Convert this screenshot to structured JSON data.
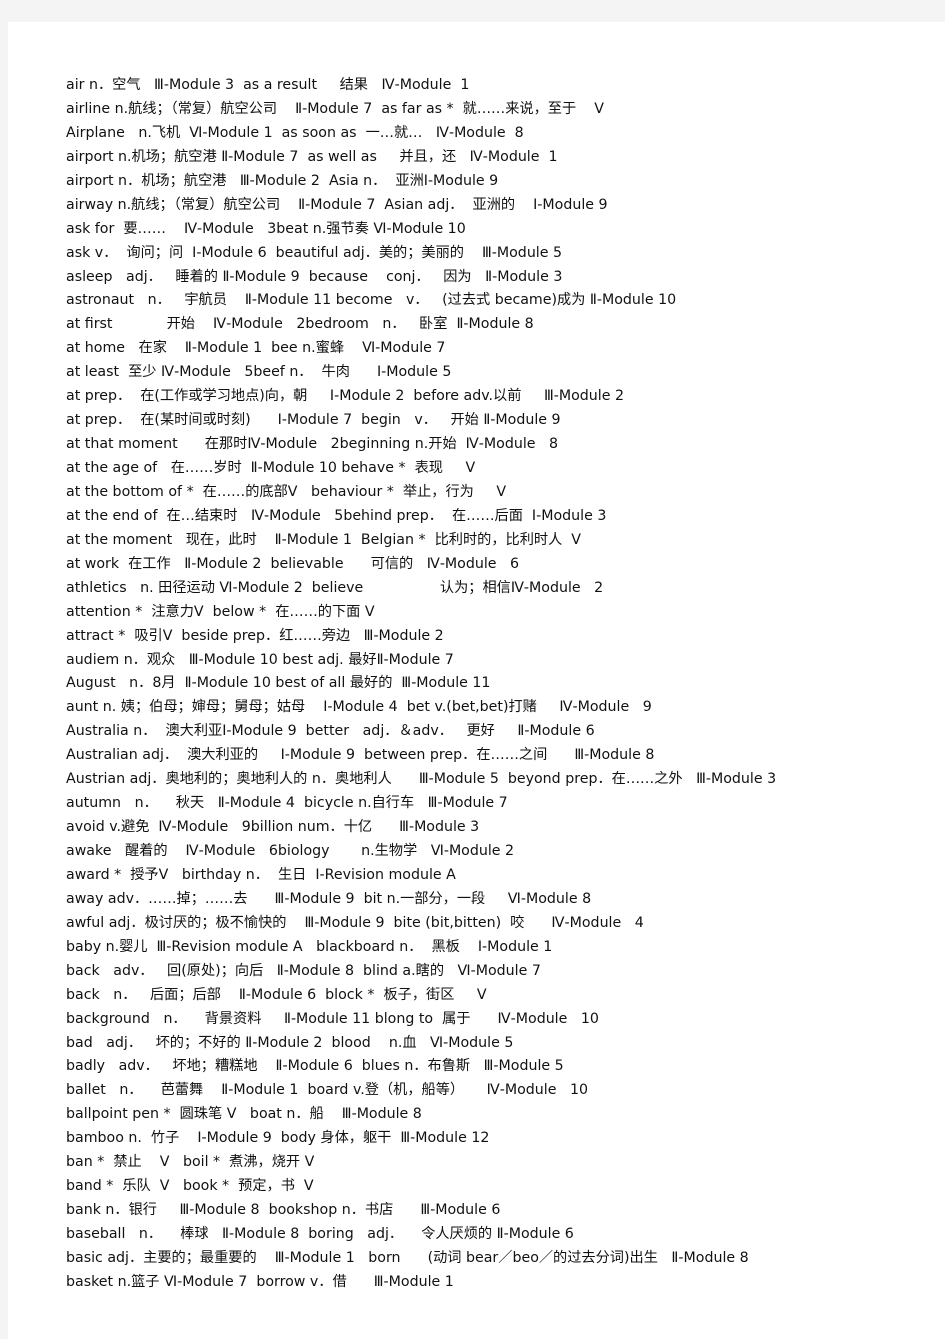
{
  "document": {
    "lines": [
      "air n．空气   Ⅲ-Module 3  as a result     结果   Ⅳ-Module  1",
      "airline n.航线；（常复）航空公司    Ⅱ-Module 7  as far as *  就……来说，至于    Ⅴ",
      "Airplane   n.飞机  Ⅵ-Module 1  as soon as  一…就…   Ⅳ-Module  8",
      "airport n.机场；航空港 Ⅱ-Module 7  as well as     并且，还   Ⅳ-Module  1",
      "airport n．机场；航空港   Ⅲ-Module 2  Asia n．  亚洲Ⅰ-Module 9",
      "airway n.航线；（常复）航空公司    Ⅱ-Module 7  Asian adj．  亚洲的    Ⅰ-Module 9",
      "ask for  要……    Ⅳ-Module   3beat n.强节奏 Ⅵ-Module 10",
      "ask v．  询问；问  Ⅰ-Module 6  beautiful adj．美的；美丽的    Ⅲ-Module 5",
      "asleep   adj．   睡着的 Ⅱ-Module 9  because    conj．   因为   Ⅱ-Module 3",
      "astronaut   n．   宇航员    Ⅱ-Module 11 become   v．   (过去式 became)成为 Ⅱ-Module 10",
      "at first            开始    Ⅳ-Module   2bedroom   n．   卧室  Ⅱ-Module 8",
      "at home   在家    Ⅱ-Module 1  bee n.蜜蜂    Ⅵ-Module 7",
      "at least  至少 Ⅳ-Module   5beef n．  牛肉      Ⅰ-Module 5",
      "at prep．  在(工作或学习地点)向，朝     Ⅰ-Module 2  before adv.以前     Ⅲ-Module 2",
      "at prep．  在(某时间或时刻)      Ⅰ-Module 7  begin   v．   开始 Ⅱ-Module 9",
      "at that moment      在那时Ⅳ-Module   2beginning n.开始  Ⅳ-Module   8",
      "at the age of   在……岁时  Ⅱ-Module 10 behave *  表现     Ⅴ",
      "at the bottom of *  在……的底部Ⅴ   behaviour *  举止，行为     Ⅴ",
      "at the end of  在…结束时   Ⅳ-Module   5behind prep．  在……后面  Ⅰ-Module 3",
      "at the moment   现在，此时    Ⅱ-Module 1  Belgian *  比利时的，比利时人  Ⅴ",
      "at work  在工作   Ⅱ-Module 2  believable      可信的   Ⅳ-Module   6",
      "athletics   n. 田径运动 Ⅵ-Module 2  believe                 认为；相信Ⅳ-Module   2",
      "attention *  注意力Ⅴ  below *  在……的下面 Ⅴ",
      "attract *  吸引Ⅴ  beside prep．红……旁边   Ⅲ-Module 2",
      "audiem n．观众   Ⅲ-Module 10 best adj. 最好Ⅱ-Module 7",
      "August   n．8月  Ⅱ-Module 10 best of all 最好的  Ⅲ-Module 11",
      "aunt n. 姨；伯母；婶母；舅母；姑母    Ⅰ-Module 4  bet v.(bet,bet)打赌     Ⅳ-Module   9",
      "Australia n．  澳大利亚Ⅰ-Module 9  better   adj．＆adv．   更好     Ⅱ-Module 6",
      "Australian adj．  澳大利亚的     Ⅰ-Module 9  between prep．在……之间      Ⅲ-Module 8",
      "Austrian adj．奥地利的；奥地利人的 n．奥地利人      Ⅲ-Module 5  beyond prep．在……之外   Ⅲ-Module 3",
      "autumn   n．    秋天   Ⅱ-Module 4  bicycle n.自行车   Ⅲ-Module 7",
      "avoid v.避免  Ⅳ-Module   9billion num．十亿      Ⅲ-Module 3",
      "awake   醒着的    Ⅳ-Module   6biology       n.生物学   Ⅵ-Module 2",
      "award *  授予Ⅴ   birthday n．  生日  Ⅰ-Revision module A",
      "away adv．……掉；……去      Ⅲ-Module 9  bit n.一部分，一段     Ⅵ-Module 8",
      "awful adj．极讨厌的；极不愉快的    Ⅲ-Module 9  bite (bit,bitten)  咬      Ⅳ-Module   4",
      "baby n.婴儿  Ⅲ-Revision module A   blackboard n．  黑板    Ⅰ-Module 1",
      "back   adv．   回(原处)；向后   Ⅱ-Module 8  blind a.瞎的   Ⅵ-Module 7",
      "back   n．   后面；后部    Ⅱ-Module 6  block *  板子，街区     Ⅴ",
      "background   n．    背景资料     Ⅱ-Module 11 blong to  属于      Ⅳ-Module   10",
      "bad   adj．   坏的；不好的 Ⅱ-Module 2  blood    n.血   Ⅵ-Module 5",
      "badly   adv．   坏地；糟糕地    Ⅱ-Module 6  blues n．布鲁斯   Ⅲ-Module 5",
      "ballet   n．    芭蕾舞    Ⅱ-Module 1  board v.登（机，船等）     Ⅳ-Module   10",
      "ballpoint pen *  圆珠笔 Ⅴ   boat n．船    Ⅲ-Module 8",
      "bamboo n.  竹子    Ⅰ-Module 9  body 身体，躯干  Ⅲ-Module 12",
      "ban *  禁止    Ⅴ   boil *  煮沸，烧开 Ⅴ",
      "band *  乐队  Ⅴ   book *  预定，书  Ⅴ",
      "bank n．银行     Ⅲ-Module 8  bookshop n．书店      Ⅲ-Module 6",
      "baseball   n．    棒球   Ⅱ-Module 8  boring   adj．    令人厌烦的 Ⅱ-Module 6",
      "basic adj．主要的；最重要的    Ⅲ-Module 1   born      (动词 bear／beo／的过去分词)出生   Ⅱ-Module 8",
      "basket n.篮子 Ⅵ-Module 7  borrow v．借      Ⅲ-Module 1"
    ]
  }
}
